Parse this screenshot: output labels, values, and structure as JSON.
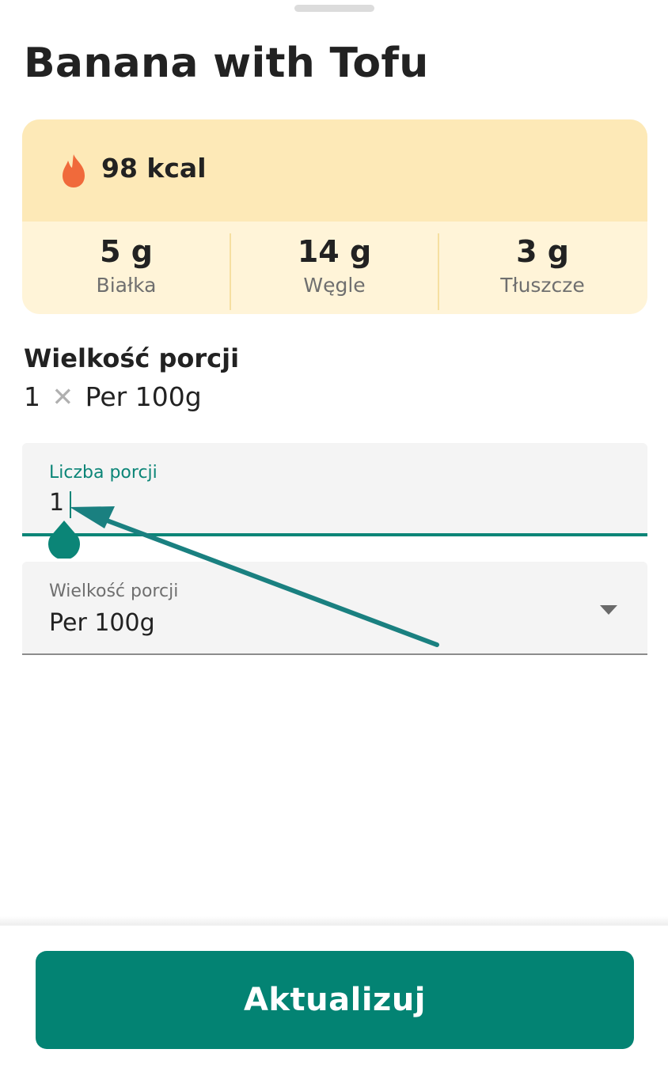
{
  "sheet": {
    "title": "Banana with Tofu"
  },
  "nutrition": {
    "calories": "98 kcal",
    "calorie_icon": "flame-icon",
    "macros": [
      {
        "value": "5 g",
        "label": "Białka"
      },
      {
        "value": "14 g",
        "label": "Węgle"
      },
      {
        "value": "3 g",
        "label": "Tłuszcze"
      }
    ],
    "colors": {
      "kcal_background": "#fde9b7",
      "macro_background": "#fff4d8",
      "flame": "#f06a3b"
    }
  },
  "portion": {
    "heading": "Wielkość porcji",
    "count": "1",
    "times_symbol": "✕",
    "unit": "Per 100g"
  },
  "form": {
    "servings_label": "Liczba porcji",
    "servings_value": "1",
    "portion_label": "Wielkość porcji",
    "portion_value": "Per 100g"
  },
  "footer": {
    "update_label": "Aktualizuj"
  },
  "theme": {
    "accent": "#038373",
    "annotation_arrow": "#1a8080"
  }
}
